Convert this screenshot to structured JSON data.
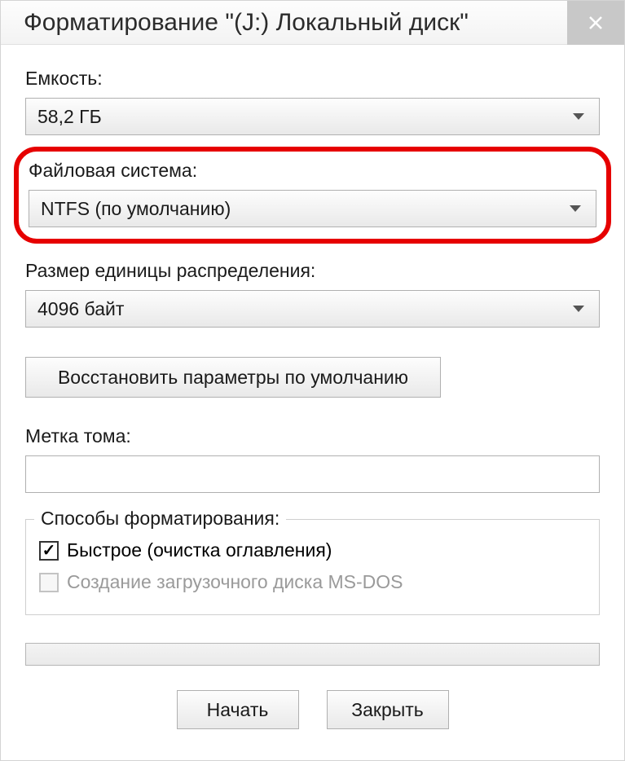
{
  "window": {
    "title": "Форматирование \"(J:) Локальный диск\""
  },
  "fields": {
    "capacity": {
      "label": "Емкость:",
      "value": "58,2 ГБ"
    },
    "filesystem": {
      "label": "Файловая система:",
      "value": "NTFS (по умолчанию)"
    },
    "allocation": {
      "label": "Размер единицы распределения:",
      "value": "4096 байт"
    },
    "volume_label": {
      "label": "Метка тома:",
      "value": ""
    }
  },
  "buttons": {
    "restore_defaults": "Восстановить параметры по умолчанию",
    "start": "Начать",
    "close": "Закрыть"
  },
  "groupbox": {
    "legend": "Способы форматирования:",
    "quick": {
      "label": "Быстрое (очистка оглавления)",
      "checked": true
    },
    "msdos": {
      "label": "Создание загрузочного диска MS-DOS",
      "checked": false,
      "disabled": true
    }
  },
  "colors": {
    "highlight": "#e60000"
  }
}
